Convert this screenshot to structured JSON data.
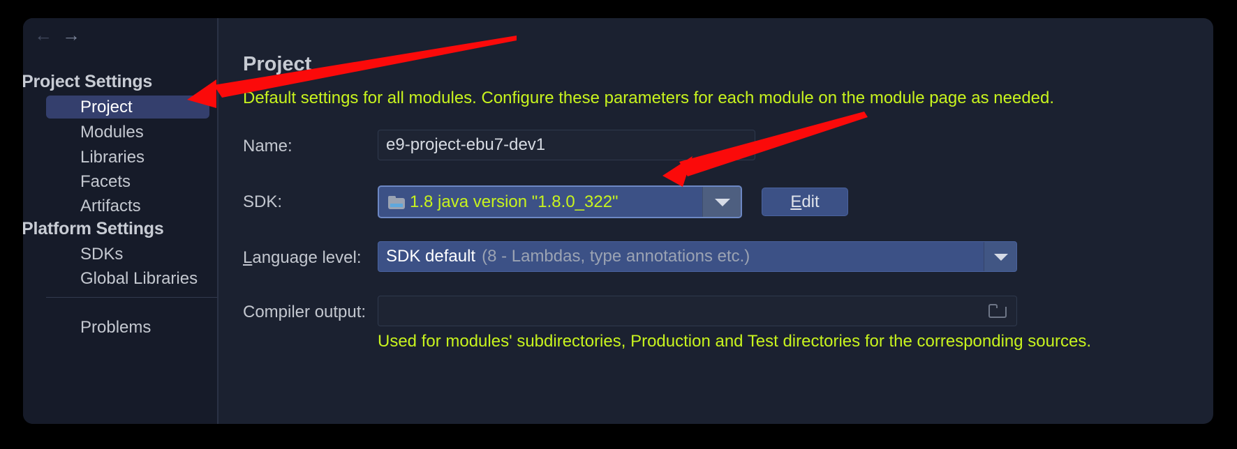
{
  "dialog": {
    "nav": {
      "back_icon": "arrow-left-icon",
      "forward_icon": "arrow-right-icon",
      "back_glyph": "←",
      "forward_glyph": "→"
    }
  },
  "sidebar": {
    "groups": [
      {
        "label": "Project Settings",
        "items": [
          {
            "label": "Project",
            "selected": true
          },
          {
            "label": "Modules",
            "selected": false
          },
          {
            "label": "Libraries",
            "selected": false
          },
          {
            "label": "Facets",
            "selected": false
          },
          {
            "label": "Artifacts",
            "selected": false
          }
        ]
      },
      {
        "label": "Platform Settings",
        "items": [
          {
            "label": "SDKs",
            "selected": false
          },
          {
            "label": "Global Libraries",
            "selected": false
          }
        ]
      }
    ],
    "footer_items": [
      {
        "label": "Problems",
        "selected": false
      }
    ]
  },
  "main": {
    "title": "Project",
    "description": "Default settings for all modules. Configure these parameters for each module on the module page as needed.",
    "fields": {
      "name": {
        "label": "Name:",
        "value": "e9-project-ebu7-dev1",
        "placeholder": ""
      },
      "sdk": {
        "label": "SDK:",
        "value": "1.8 java version \"1.8.0_322\"",
        "icon": "folder-icon",
        "dropdown_icon": "chevron-down-icon",
        "edit_button": {
          "mnemonic": "E",
          "rest": "dit"
        }
      },
      "language_level": {
        "label_mnemonic": "L",
        "label_rest": "anguage level:",
        "value": "SDK default",
        "hint": "(8 - Lambdas, type annotations etc.)",
        "dropdown_icon": "chevron-down-icon"
      },
      "compiler_output": {
        "label": "Compiler output:",
        "value": "",
        "browse_icon": "folder-open-icon",
        "hint": "Used for modules' subdirectories, Production and Test directories for the corresponding sources."
      }
    }
  },
  "annotations": {
    "arrow_color": "#fb0a0a",
    "arrows": [
      {
        "name": "arrow-to-project-sidebar-item",
        "target": "Project sidebar item"
      },
      {
        "name": "arrow-to-sdk-dropdown",
        "target": "SDK dropdown"
      }
    ]
  },
  "colors": {
    "accent_yellow": "#c8f31e",
    "selection_blue": "#343f6d",
    "combo_blue": "#3c5186",
    "dialog_bg": "#1b2130",
    "sidebar_bg": "#161b29"
  }
}
